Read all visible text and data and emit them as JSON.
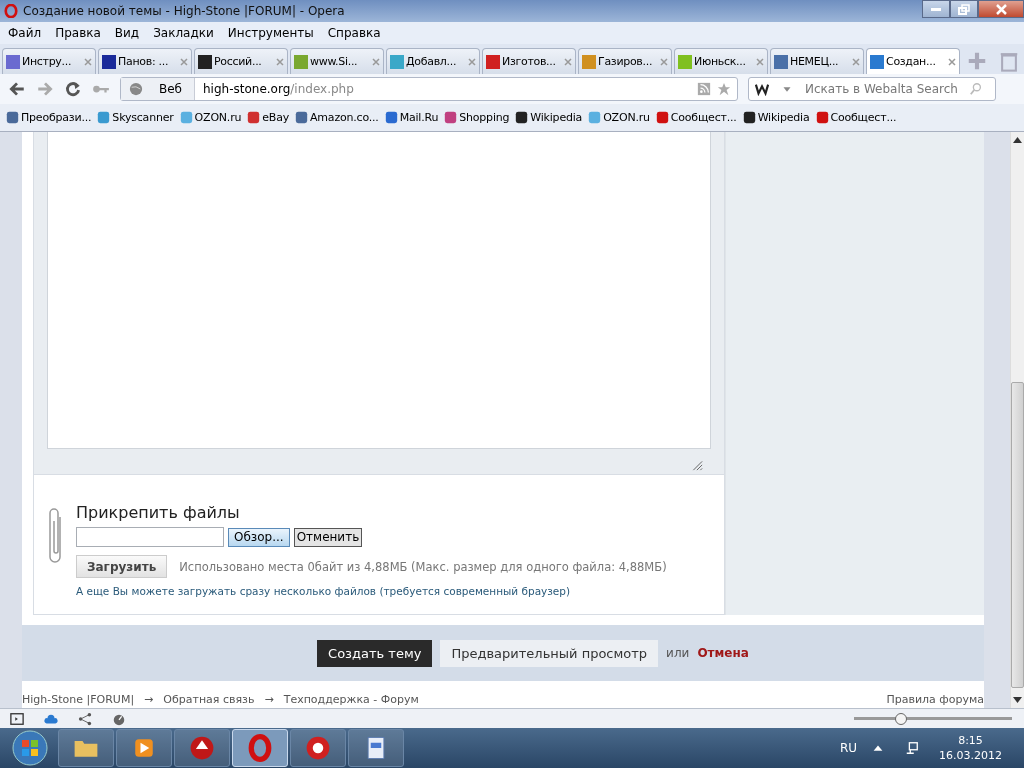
{
  "window": {
    "title": "Создание новой темы - High-Stone |FORUM| - Opera"
  },
  "menu": [
    "Файл",
    "Правка",
    "Вид",
    "Закладки",
    "Инструменты",
    "Справка"
  ],
  "tabs": [
    {
      "label": "Инстру...",
      "selected": false,
      "color": "#6a6ad0"
    },
    {
      "label": "Панов: ...",
      "selected": false,
      "color": "#1a2a9a"
    },
    {
      "label": "Россий...",
      "selected": false,
      "color": "#222222"
    },
    {
      "label": "www.Si...",
      "selected": false,
      "color": "#7aa830"
    },
    {
      "label": "Добавл...",
      "selected": false,
      "color": "#3aa8c8"
    },
    {
      "label": "Изготов...",
      "selected": false,
      "color": "#d02020"
    },
    {
      "label": "Газиров...",
      "selected": false,
      "color": "#d09020"
    },
    {
      "label": "Июньск...",
      "selected": false,
      "color": "#80c020"
    },
    {
      "label": "НЕМЕЦ...",
      "selected": false,
      "color": "#4a70a8"
    },
    {
      "label": "Создан...",
      "selected": true,
      "color": "#2a7ad0"
    }
  ],
  "address": {
    "mode": "Веб",
    "host": "high-stone.org",
    "path": "/index.php"
  },
  "search": {
    "placeholder": "Искать в Webalta Search"
  },
  "bookmarks": [
    {
      "label": "Преобрази...",
      "color": "#4a6a9a"
    },
    {
      "label": "Skyscanner",
      "color": "#3a9ad0"
    },
    {
      "label": "OZON.ru",
      "color": "#5ab0e0"
    },
    {
      "label": "eBay",
      "color": "#d03030"
    },
    {
      "label": "Amazon.co...",
      "color": "#4a6a9a"
    },
    {
      "label": "Mail.Ru",
      "color": "#2a6ad0"
    },
    {
      "label": "Shopping",
      "color": "#c04080"
    },
    {
      "label": "Wikipedia",
      "color": "#222222"
    },
    {
      "label": "OZON.ru",
      "color": "#5ab0e0"
    },
    {
      "label": "Сообщест...",
      "color": "#d01010"
    },
    {
      "label": "Wikipedia",
      "color": "#222222"
    },
    {
      "label": "Сообщест...",
      "color": "#d01010"
    }
  ],
  "attach": {
    "title": "Прикрепить файлы",
    "browse": "Обзор...",
    "cancel": "Отменить",
    "upload": "Загрузить",
    "usage": "Использовано места 0байт из 4,88МБ (Макс. размер для одного файла: 4,88МБ)",
    "multi_link": "А еще Вы можете загружать сразу несколько файлов (требуется современный браузер)"
  },
  "actions": {
    "create": "Создать тему",
    "preview": "Предварительный просмотр",
    "or": "или",
    "cancel": "Отмена"
  },
  "breadcrumbs": [
    {
      "label": "High-Stone |FORUM|"
    },
    {
      "label": "Обратная связь"
    },
    {
      "label": "Техподдержка - Форум"
    }
  ],
  "breadcrumb_separator": "→",
  "rules_link": "Правила форума",
  "status_bar": {
    "zoom": {
      "level": 0.28
    }
  },
  "taskbar": {
    "apps": [
      {
        "kind": "folder",
        "selected": false
      },
      {
        "kind": "media",
        "selected": false
      },
      {
        "kind": "poker",
        "selected": false
      },
      {
        "kind": "opera",
        "selected": true
      },
      {
        "kind": "chips",
        "selected": false
      },
      {
        "kind": "document",
        "selected": false
      }
    ],
    "language": "RU",
    "time": "8:15",
    "date": "16.03.2012"
  }
}
